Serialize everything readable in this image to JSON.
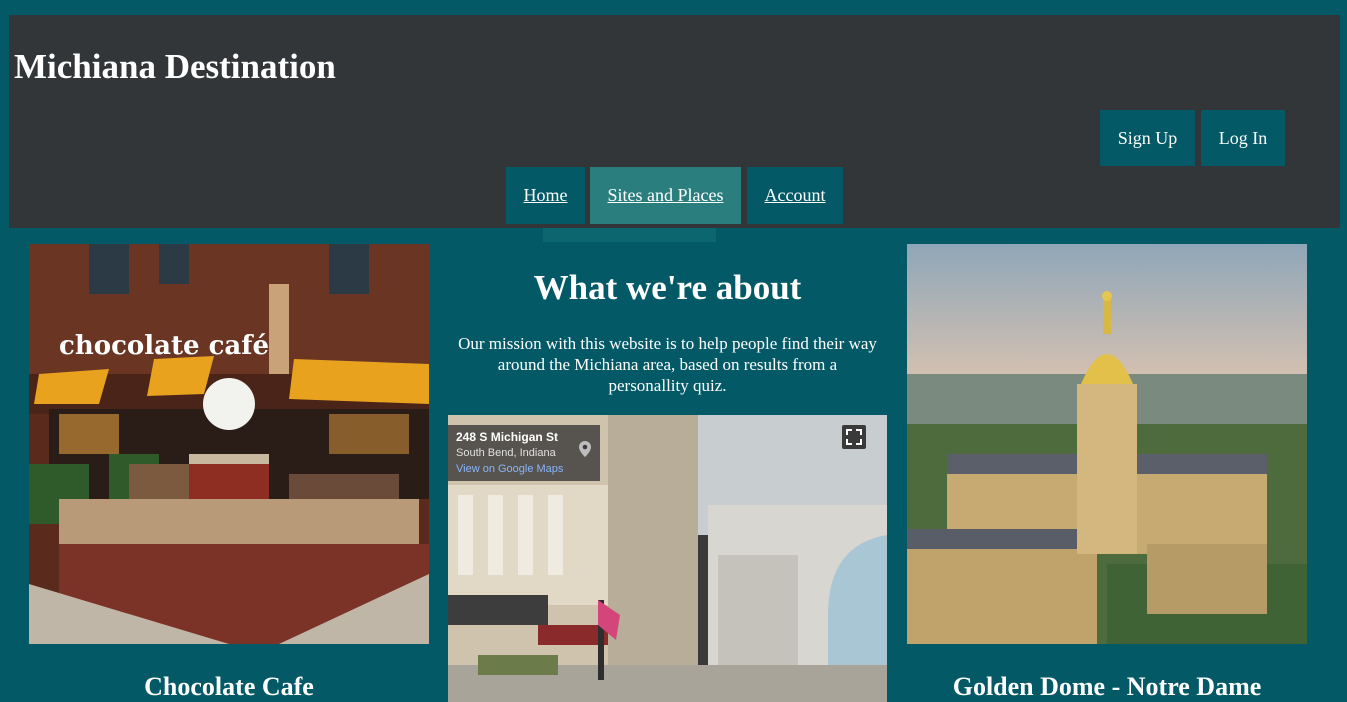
{
  "header": {
    "site_title": "Michiana Destination",
    "auth": {
      "signup_label": "Sign Up",
      "login_label": "Log In"
    },
    "nav": {
      "home": "Home",
      "sites": "Sites and Places",
      "account": "Account"
    }
  },
  "about": {
    "title": "What we're about",
    "text": "Our mission with this website is to help people find their way around the Michiana area, based on results from a personallity quiz."
  },
  "map": {
    "address": "248 S Michigan St",
    "city": "South Bend, Indiana",
    "link": "View on Google Maps"
  },
  "cards": {
    "left_caption": "Chocolate Cafe",
    "right_caption": "Golden Dome - Notre Dame"
  },
  "icons": [
    "map-pin-icon",
    "fullscreen-icon"
  ],
  "colors": {
    "background": "#035a66",
    "header": "#333638",
    "active_nav": "#2a7f7e"
  }
}
